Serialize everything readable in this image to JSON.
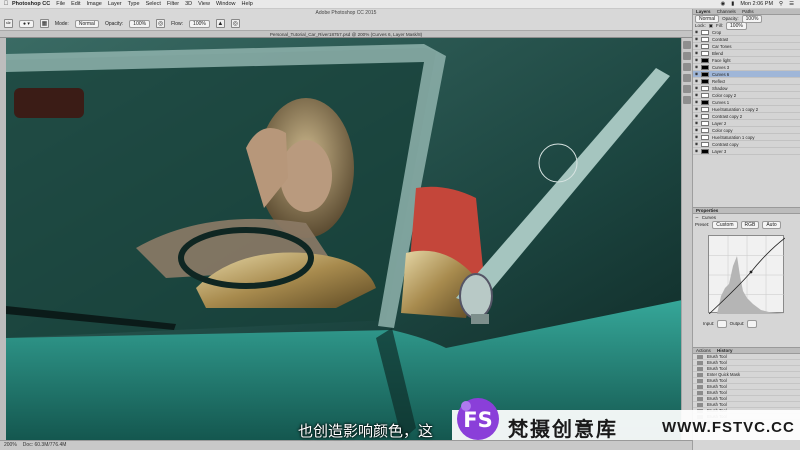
{
  "menubar": {
    "app_name": "Photoshop CC",
    "items": [
      "File",
      "Edit",
      "Image",
      "Layer",
      "Type",
      "Select",
      "Filter",
      "3D",
      "View",
      "Window",
      "Help"
    ],
    "clock": "Mon 2:06 PM"
  },
  "window_title": "Adobe Photoshop CC 2015",
  "options_bar": {
    "mode_label": "Mode:",
    "mode_value": "Normal",
    "opacity_label": "Opacity:",
    "opacity_value": "100%",
    "flow_label": "Flow:",
    "flow_value": "100%"
  },
  "document_tab": "Personal_Tutorial_Car_River18757.psd @ 200% (Curves 6, Layer Mask/8)",
  "status_bar": {
    "zoom": "200%",
    "doc_info": "Doc: 60.3M/776.4M"
  },
  "layers_panel": {
    "tabs": [
      "Layers",
      "Channels",
      "Paths"
    ],
    "blend_mode": "Normal",
    "opacity_label": "Opacity:",
    "opacity_value": "100%",
    "fill_label": "Fill:",
    "fill_value": "100%",
    "lock_label": "Lock:",
    "layers": [
      {
        "name": "Crop",
        "thumb": "white",
        "selected": false
      },
      {
        "name": "Contrast",
        "thumb": "white",
        "selected": false
      },
      {
        "name": "Car Tones",
        "thumb": "white",
        "selected": false
      },
      {
        "name": "Blend",
        "thumb": "white",
        "selected": false
      },
      {
        "name": "Face light",
        "thumb": "dark",
        "selected": false
      },
      {
        "name": "Curves 3",
        "thumb": "dark",
        "selected": false
      },
      {
        "name": "Curves 6",
        "thumb": "dark",
        "selected": true
      },
      {
        "name": "Reflect",
        "thumb": "dark",
        "selected": false
      },
      {
        "name": "Shadow",
        "thumb": "white",
        "selected": false
      },
      {
        "name": "Color copy 2",
        "thumb": "white",
        "selected": false
      },
      {
        "name": "Curves 1",
        "thumb": "dark",
        "selected": false
      },
      {
        "name": "Hue/Saturation 1 copy 2",
        "thumb": "white",
        "selected": false
      },
      {
        "name": "Contrast copy 2",
        "thumb": "white",
        "selected": false
      },
      {
        "name": "Layer 2",
        "thumb": "white",
        "selected": false
      },
      {
        "name": "Color copy",
        "thumb": "white",
        "selected": false
      },
      {
        "name": "Hue/Saturation 1 copy",
        "thumb": "white",
        "selected": false
      },
      {
        "name": "Contrast copy",
        "thumb": "white",
        "selected": false
      },
      {
        "name": "Layer 3",
        "thumb": "dark",
        "selected": false
      }
    ]
  },
  "properties_panel": {
    "tabs": [
      "Properties"
    ],
    "title": "Curves",
    "preset_label": "Preset:",
    "preset_value": "Custom",
    "channel_value": "RGB",
    "auto_label": "Auto",
    "input_label": "Input:",
    "output_label": "Output:"
  },
  "history_panel": {
    "tabs": [
      "Actions",
      "History"
    ],
    "items": [
      "Brush Tool",
      "Brush Tool",
      "Brush Tool",
      "Enter Quick Mask",
      "Brush Tool",
      "Brush Tool",
      "Brush Tool",
      "Brush Tool",
      "Brush Tool",
      "Brush Tool",
      "Brush Tool",
      "Brush Tool"
    ]
  },
  "subtitle": "也创造影响颜色，这",
  "watermark": {
    "text_cn": "梵摄创意库",
    "url": "WWW.FSTVC.CC",
    "logo_letters": "FS"
  },
  "colors": {
    "canvas_teal": "#1e4a44",
    "car_body": "#2a8f84",
    "selection_blue": "#9fb6d8",
    "logo_purple": "#8a3fd9"
  }
}
